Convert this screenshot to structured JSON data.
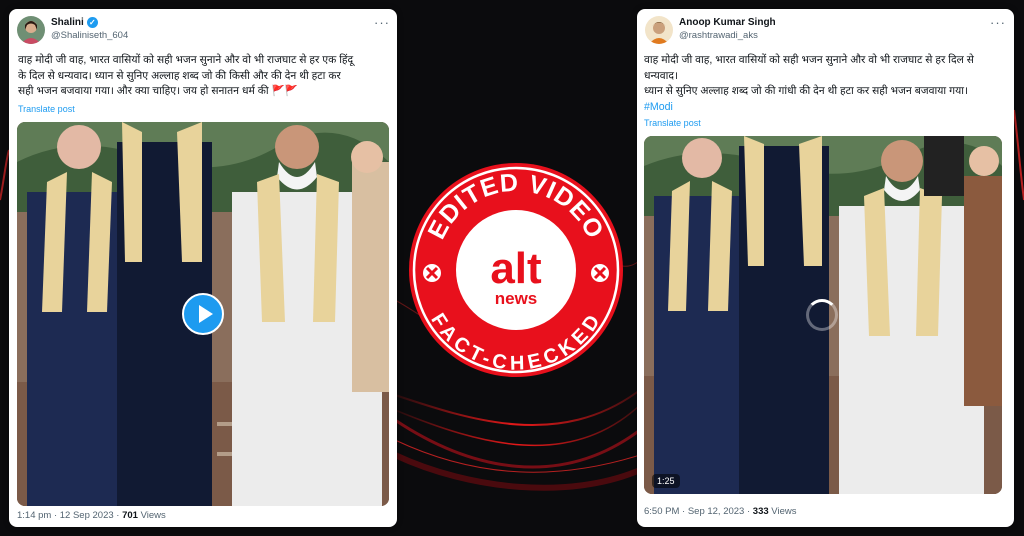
{
  "left_tweet": {
    "author": "Shalini",
    "handle": "@Shaliniseth_604",
    "text_lines": [
      "वाह मोदी जी वाह, भारत वासियों को सही भजन सुनाने और वो भी राजघाट से हर एक हिंदू",
      "के दिल से धन्यवाद। ध्यान से सुनिए अल्लाह शब्द जो की किसी और की देन थी हटा कर",
      "सही भजन बजवाया गया। और क्या चाहिए। जय हो सनातन धर्म की 🚩🚩"
    ],
    "translate": "Translate post",
    "time": "1:14 pm · 12 Sep 2023 · ",
    "views_count": "701",
    "views_label": " Views",
    "more": "···"
  },
  "right_tweet": {
    "author": "Anoop Kumar Singh",
    "handle": "@rashtrawadi_aks",
    "text_lines": [
      "वाह मोदी जी वाह, भारत वासियों को सही भजन सुनाने और वो भी राजघाट से हर  दिल से",
      "धन्यवाद।",
      "ध्यान से सुनिए अल्लाह शब्द जो की गांधी की देन थी हटा कर सही भजन बजवाया गया।"
    ],
    "hashtag": "#Modi",
    "translate": "Translate post",
    "time": "6:50 PM · Sep 12, 2023 · ",
    "views_count": "333",
    "views_label": " Views",
    "duration": "1:25",
    "more": "···"
  },
  "badge": {
    "top_text": "EDITED VIDEO",
    "bottom_text": "FACT-CHECKED",
    "brand_main": "alt",
    "brand_sub": "news"
  },
  "colors": {
    "badge_red": "#e8101c",
    "twitter_blue": "#1d9bf0",
    "background": "#0b0b0d"
  },
  "icons": [
    "verified-icon",
    "more-options-icon",
    "play-icon",
    "loading-spinner-icon",
    "cross-mark-icon"
  ]
}
